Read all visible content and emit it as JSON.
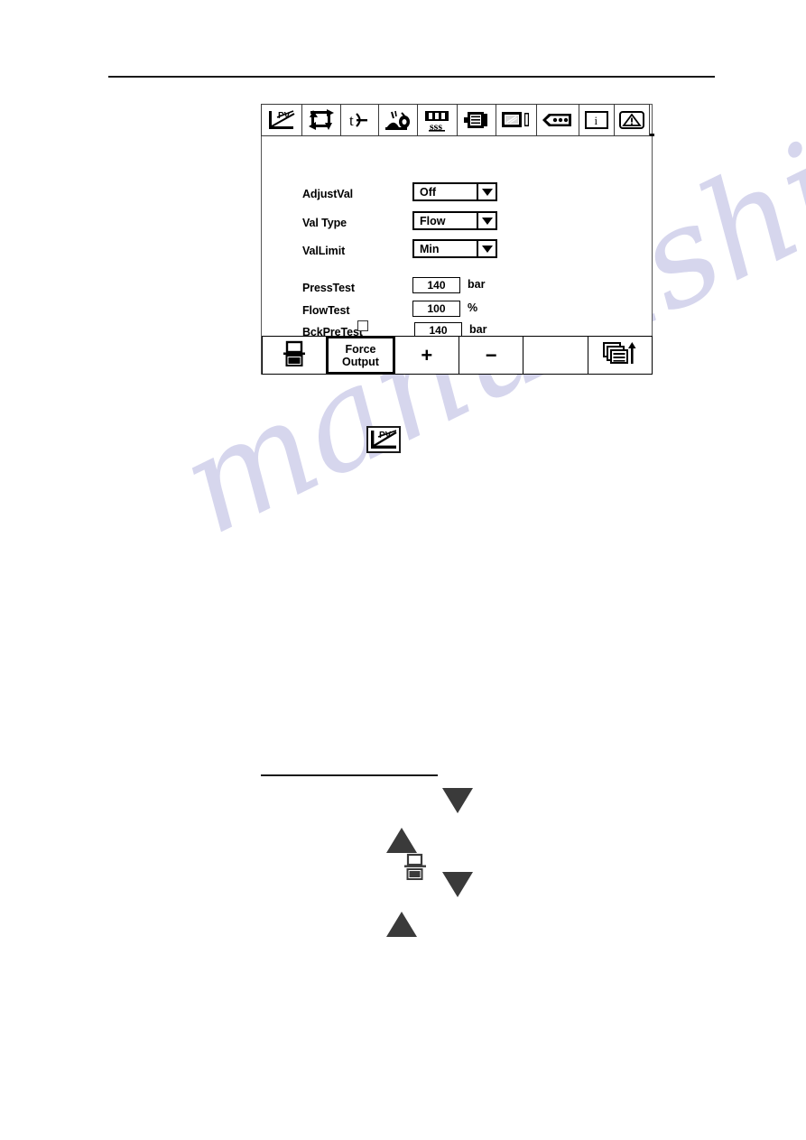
{
  "document": {
    "page_background": "#ffffff",
    "rule_color": "#1a1a1a",
    "watermark_text": "manualshive.com"
  },
  "device_panel": {
    "toolbar": {
      "name": "device-toolbar",
      "items": [
        {
          "icon": "pv-graph-icon",
          "label": "PV"
        },
        {
          "icon": "cycle-loop-icon",
          "label": "Cycle"
        },
        {
          "icon": "timer-icon",
          "label": "t"
        },
        {
          "icon": "mixer-icon",
          "label": "Mixer"
        },
        {
          "icon": "heater-bands-icon",
          "label": "Heating"
        },
        {
          "icon": "motor-icon",
          "label": "Motor"
        },
        {
          "icon": "screen-module-icon",
          "label": "Display"
        },
        {
          "icon": "nozzle-icon",
          "label": "Nozzle"
        },
        {
          "icon": "info-icon",
          "label": "i"
        },
        {
          "icon": "alarm-warning-icon",
          "label": "Alarm"
        }
      ]
    },
    "fields": [
      {
        "label": "AdjustVal",
        "type": "dropdown",
        "value": "Off"
      },
      {
        "label": "Val Type",
        "type": "dropdown",
        "value": "Flow"
      },
      {
        "label": "ValLimit",
        "type": "dropdown",
        "value": "Min"
      }
    ],
    "numeric_fields": [
      {
        "label": "PressTest",
        "value": "140",
        "unit": "bar"
      },
      {
        "label": "FlowTest",
        "value": "100",
        "unit": "%"
      },
      {
        "label": "BckPreTest",
        "value": "140",
        "unit": "bar"
      }
    ],
    "checkbox": {
      "name": "option-checkbox",
      "checked": false
    },
    "buttons": [
      {
        "label": "",
        "icon": "transfer-download-icon",
        "selected": false
      },
      {
        "label": "Force\nOutput",
        "line1": "Force",
        "line2": "Output",
        "icon": "",
        "selected": true
      },
      {
        "label": "+",
        "icon": "",
        "selected": false
      },
      {
        "label": "−",
        "icon": "",
        "selected": false
      },
      {
        "label": "",
        "icon": "",
        "selected": false
      },
      {
        "label": "",
        "icon": "list-exit-icon",
        "selected": false
      }
    ]
  },
  "standalone_icons": [
    {
      "name": "pv-graph-icon",
      "label": "PV"
    },
    {
      "name": "triangle-up-icon",
      "label": "Up"
    },
    {
      "name": "triangle-down-icon",
      "label": "Down"
    },
    {
      "name": "transfer-download-icon",
      "label": "Transfer"
    },
    {
      "name": "triangle-up-icon-2",
      "label": "Up"
    },
    {
      "name": "triangle-down-icon-2",
      "label": "Down"
    }
  ]
}
